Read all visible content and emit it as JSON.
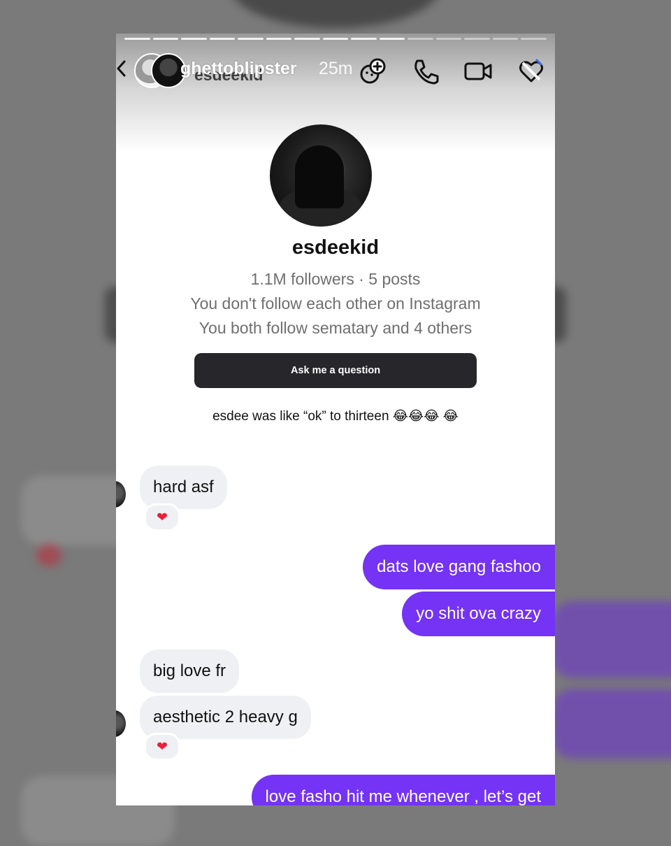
{
  "story": {
    "username": "ghettoblipster",
    "time": "25m",
    "overlay_username": "esdeekid",
    "icons": [
      "back-chevron-icon",
      "add-reaction-icon",
      "phone-icon",
      "video-icon",
      "heart-icon"
    ]
  },
  "profile": {
    "name": "esdeekid",
    "stats": "1.1M followers · 5 posts",
    "follow_status": "You don't follow each other on Instagram",
    "mutuals": "You both follow sematary and 4 others"
  },
  "ask_button": {
    "label": "Ask me a question"
  },
  "caption": "esdee was like “ok” to thirteen 😂😂😂 😂",
  "messages": [
    {
      "dir": "in",
      "text": "hard asf",
      "reaction": "❤"
    },
    {
      "dir": "out",
      "text": "dats love gang fashoo"
    },
    {
      "dir": "out",
      "text": "yo shit ova crazy"
    },
    {
      "dir": "in",
      "text": "big love fr"
    },
    {
      "dir": "in",
      "text": "aesthetic 2 heavy g",
      "reaction": "❤"
    },
    {
      "dir": "out",
      "text": "love fasho hit me whenever , let’s get"
    }
  ],
  "colors": {
    "outgoing_bubble": "#7433f5",
    "incoming_bubble": "#eff0f3",
    "ask_button": "#26262b",
    "reaction_heart": "#e8213a"
  }
}
